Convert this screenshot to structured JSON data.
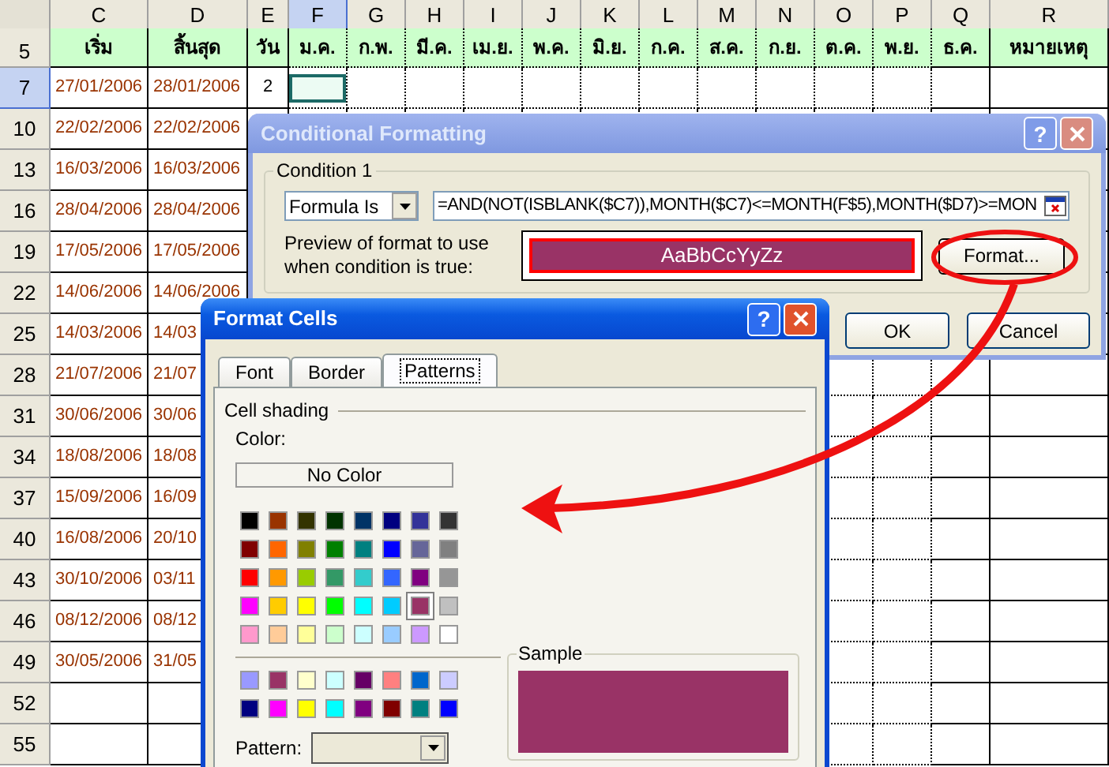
{
  "sheet": {
    "columns": [
      {
        "letter": "C",
        "selected": false
      },
      {
        "letter": "D",
        "selected": false
      },
      {
        "letter": "E",
        "selected": false
      },
      {
        "letter": "F",
        "selected": true
      },
      {
        "letter": "G",
        "selected": false
      },
      {
        "letter": "H",
        "selected": false
      },
      {
        "letter": "I",
        "selected": false
      },
      {
        "letter": "J",
        "selected": false
      },
      {
        "letter": "K",
        "selected": false
      },
      {
        "letter": "L",
        "selected": false
      },
      {
        "letter": "M",
        "selected": false
      },
      {
        "letter": "N",
        "selected": false
      },
      {
        "letter": "O",
        "selected": false
      },
      {
        "letter": "P",
        "selected": false
      },
      {
        "letter": "Q",
        "selected": false
      },
      {
        "letter": "R",
        "selected": false
      }
    ],
    "header_row": {
      "number": "5",
      "headings": [
        "เริ่ม",
        "สิ้นสุด",
        "วัน",
        "ม.ค.",
        "ก.พ.",
        "มี.ค.",
        "เม.ย.",
        "พ.ค.",
        "มิ.ย.",
        "ก.ค.",
        "ส.ค.",
        "ก.ย.",
        "ต.ค.",
        "พ.ย.",
        "ธ.ค.",
        "หมายเหตุ"
      ]
    },
    "rows": [
      {
        "number": "7",
        "selected": true,
        "start": "27/01/2006",
        "end": "28/01/2006",
        "days": "2"
      },
      {
        "number": "10",
        "selected": false,
        "start": "22/02/2006",
        "end": "22/02/2006"
      },
      {
        "number": "13",
        "selected": false,
        "start": "16/03/2006",
        "end": "16/03/2006"
      },
      {
        "number": "16",
        "selected": false,
        "start": "28/04/2006",
        "end": "28/04/2006"
      },
      {
        "number": "19",
        "selected": false,
        "start": "17/05/2006",
        "end": "17/05/2006"
      },
      {
        "number": "22",
        "selected": false,
        "start": "14/06/2006",
        "end": "14/06/2006"
      },
      {
        "number": "25",
        "selected": false,
        "start": "14/03/2006",
        "end": "14/03"
      },
      {
        "number": "28",
        "selected": false,
        "start": "21/07/2006",
        "end": "21/07"
      },
      {
        "number": "31",
        "selected": false,
        "start": "30/06/2006",
        "end": "30/06"
      },
      {
        "number": "34",
        "selected": false,
        "start": "18/08/2006",
        "end": "18/08"
      },
      {
        "number": "37",
        "selected": false,
        "start": "15/09/2006",
        "end": "16/09"
      },
      {
        "number": "40",
        "selected": false,
        "start": "16/08/2006",
        "end": "20/10"
      },
      {
        "number": "43",
        "selected": false,
        "start": "30/10/2006",
        "end": "03/11"
      },
      {
        "number": "46",
        "selected": false,
        "start": "08/12/2006",
        "end": "08/12"
      },
      {
        "number": "49",
        "selected": false,
        "start": "30/05/2006",
        "end": "31/05"
      },
      {
        "number": "52",
        "selected": false
      },
      {
        "number": "55",
        "selected": false
      }
    ]
  },
  "conditional_formatting": {
    "title": "Conditional Formatting",
    "help": "?",
    "condition_label": "Condition 1",
    "condition_type": "Formula Is",
    "formula": "=AND(NOT(ISBLANK($C7)),MONTH($C7)<=MONTH(F$5),MONTH($D7)>=MON",
    "preview_label": "Preview of format to use when condition is true:",
    "preview_text": "AaBbCcYyZz",
    "format_button": "Format...",
    "ok_button": "OK",
    "cancel_button": "Cancel"
  },
  "format_cells": {
    "title": "Format Cells",
    "help": "?",
    "tabs": [
      {
        "label": "Font",
        "selected": false
      },
      {
        "label": "Border",
        "selected": false
      },
      {
        "label": "Patterns",
        "selected": true
      }
    ],
    "section": "Cell shading",
    "color_label": "Color:",
    "no_color": "No Color",
    "palette": [
      {
        "color": "#000000",
        "selected": false
      },
      {
        "color": "#993300",
        "selected": false
      },
      {
        "color": "#333300",
        "selected": false
      },
      {
        "color": "#003300",
        "selected": false
      },
      {
        "color": "#003366",
        "selected": false
      },
      {
        "color": "#000080",
        "selected": false
      },
      {
        "color": "#333399",
        "selected": false
      },
      {
        "color": "#333333",
        "selected": false
      },
      {
        "color": "#800000",
        "selected": false
      },
      {
        "color": "#ff6600",
        "selected": false
      },
      {
        "color": "#808000",
        "selected": false
      },
      {
        "color": "#008000",
        "selected": false
      },
      {
        "color": "#008080",
        "selected": false
      },
      {
        "color": "#0000ff",
        "selected": false
      },
      {
        "color": "#666699",
        "selected": false
      },
      {
        "color": "#808080",
        "selected": false
      },
      {
        "color": "#ff0000",
        "selected": false
      },
      {
        "color": "#ff9900",
        "selected": false
      },
      {
        "color": "#99cc00",
        "selected": false
      },
      {
        "color": "#339966",
        "selected": false
      },
      {
        "color": "#33cccc",
        "selected": false
      },
      {
        "color": "#3366ff",
        "selected": false
      },
      {
        "color": "#800080",
        "selected": false
      },
      {
        "color": "#969696",
        "selected": false
      },
      {
        "color": "#ff00ff",
        "selected": false
      },
      {
        "color": "#ffcc00",
        "selected": false
      },
      {
        "color": "#ffff00",
        "selected": false
      },
      {
        "color": "#00ff00",
        "selected": false
      },
      {
        "color": "#00ffff",
        "selected": false
      },
      {
        "color": "#00ccff",
        "selected": false
      },
      {
        "color": "#993366",
        "selected": true
      },
      {
        "color": "#c0c0c0",
        "selected": false
      },
      {
        "color": "#ff99cc",
        "selected": false
      },
      {
        "color": "#ffcc99",
        "selected": false
      },
      {
        "color": "#ffff99",
        "selected": false
      },
      {
        "color": "#ccffcc",
        "selected": false
      },
      {
        "color": "#ccffff",
        "selected": false
      },
      {
        "color": "#99ccff",
        "selected": false
      },
      {
        "color": "#cc99ff",
        "selected": false
      },
      {
        "color": "#ffffff",
        "selected": false
      }
    ],
    "chart_colors": [
      {
        "color": "#9999ff",
        "selected": false
      },
      {
        "color": "#993366",
        "selected": false
      },
      {
        "color": "#ffffcc",
        "selected": false
      },
      {
        "color": "#ccffff",
        "selected": false
      },
      {
        "color": "#660066",
        "selected": false
      },
      {
        "color": "#ff8080",
        "selected": false
      },
      {
        "color": "#0066cc",
        "selected": false
      },
      {
        "color": "#ccccff",
        "selected": false
      },
      {
        "color": "#000080",
        "selected": false
      },
      {
        "color": "#ff00ff",
        "selected": false
      },
      {
        "color": "#ffff00",
        "selected": false
      },
      {
        "color": "#00ffff",
        "selected": false
      },
      {
        "color": "#800080",
        "selected": false
      },
      {
        "color": "#800000",
        "selected": false
      },
      {
        "color": "#008080",
        "selected": false
      },
      {
        "color": "#0000ff",
        "selected": false
      }
    ],
    "pattern_label": "Pattern:",
    "sample_label": "Sample"
  }
}
